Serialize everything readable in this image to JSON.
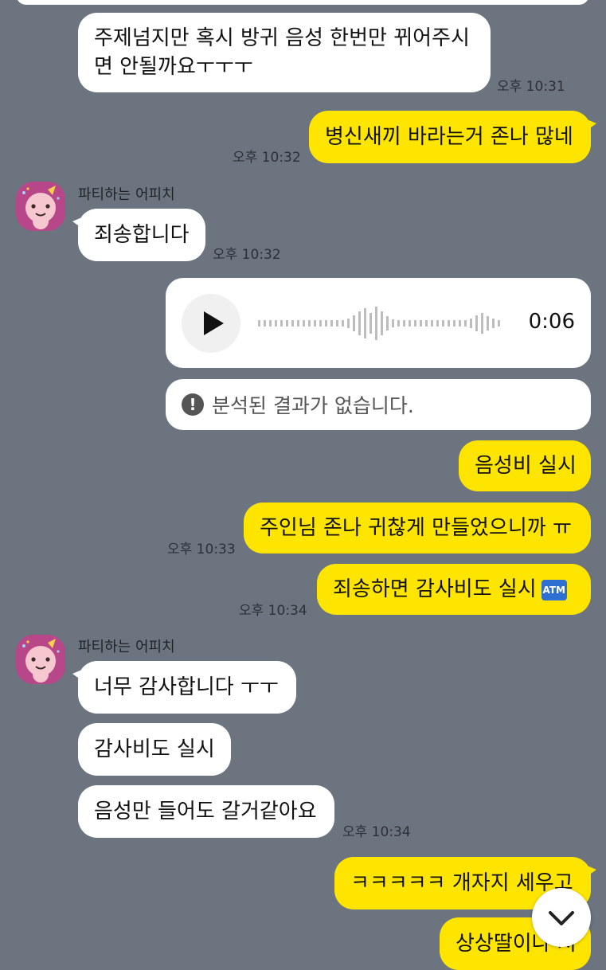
{
  "chat": {
    "sender_name": "파티하는 어피치",
    "messages": [
      {
        "from": "them",
        "text": "주제넘지만 혹시 방귀 음성 한번만 뀌어주시면 안될까요ㅜㅜㅜ",
        "time": "오후 10:31"
      },
      {
        "from": "me",
        "text": "병신새끼 바라는거 존나 많네",
        "time": "오후 10:32"
      },
      {
        "from": "them",
        "text": "죄송합니다",
        "time": "오후 10:32"
      },
      {
        "from": "me",
        "type": "voice",
        "duration": "0:06",
        "analysis": "분석된 결과가 없습니다."
      },
      {
        "from": "me",
        "text": "음성비 실시"
      },
      {
        "from": "me",
        "text": "주인님 존나 귀찮게 만들었으니까 ㅠ",
        "time": "오후 10:33"
      },
      {
        "from": "me",
        "text": "죄송하면 감사비도 실시",
        "emoji": "ATM",
        "time": "오후 10:34"
      },
      {
        "from": "them",
        "text": "너무 감사합니다 ㅜㅜ"
      },
      {
        "from": "them",
        "text": "감사비도 실시"
      },
      {
        "from": "them",
        "text": "음성만 들어도 갈거같아요",
        "time": "오후 10:34"
      },
      {
        "from": "me",
        "text": "ㅋㅋㅋㅋㅋ 개자지 세우고"
      },
      {
        "from": "me",
        "text": "상상딸이나 쳐"
      }
    ]
  },
  "icons": {
    "play": "play-icon",
    "alert": "alert-circle-icon",
    "scroll_down": "chevron-down-icon",
    "avatar": "apeach-avatar"
  },
  "colors": {
    "background": "#6c7480",
    "my_bubble": "#fee500",
    "their_bubble": "#ffffff"
  }
}
